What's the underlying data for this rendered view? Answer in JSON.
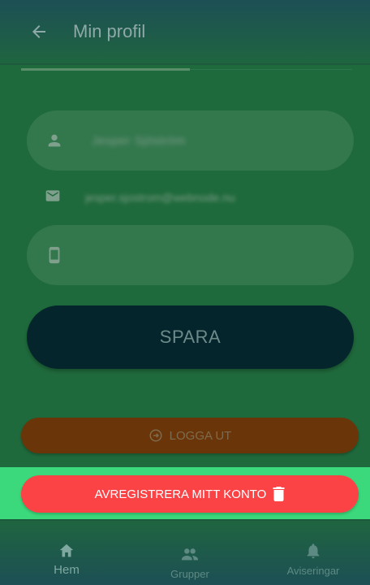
{
  "header": {
    "title": "Min profil"
  },
  "form": {
    "name_value": "Jesper Sjöström",
    "email_value": "jesper.sjostrom@webnode.nu",
    "phone_value": "",
    "save_label": "SPARA"
  },
  "actions": {
    "logout_label": "LOGGA UT",
    "unregister_label": "AVREGISTRERA MITT KONTO"
  },
  "bottom_nav": {
    "items": [
      {
        "label": "Hem",
        "icon": "home-icon"
      },
      {
        "label": "Grupper",
        "icon": "groups-icon"
      },
      {
        "label": "Aviseringar",
        "icon": "bell-icon"
      }
    ]
  },
  "colors": {
    "background": "#1f6a3c",
    "save_button": "#04252c",
    "logout_button": "#6a3609",
    "unregister_button": "#fb4346",
    "unregister_band": "#3bd97c"
  }
}
